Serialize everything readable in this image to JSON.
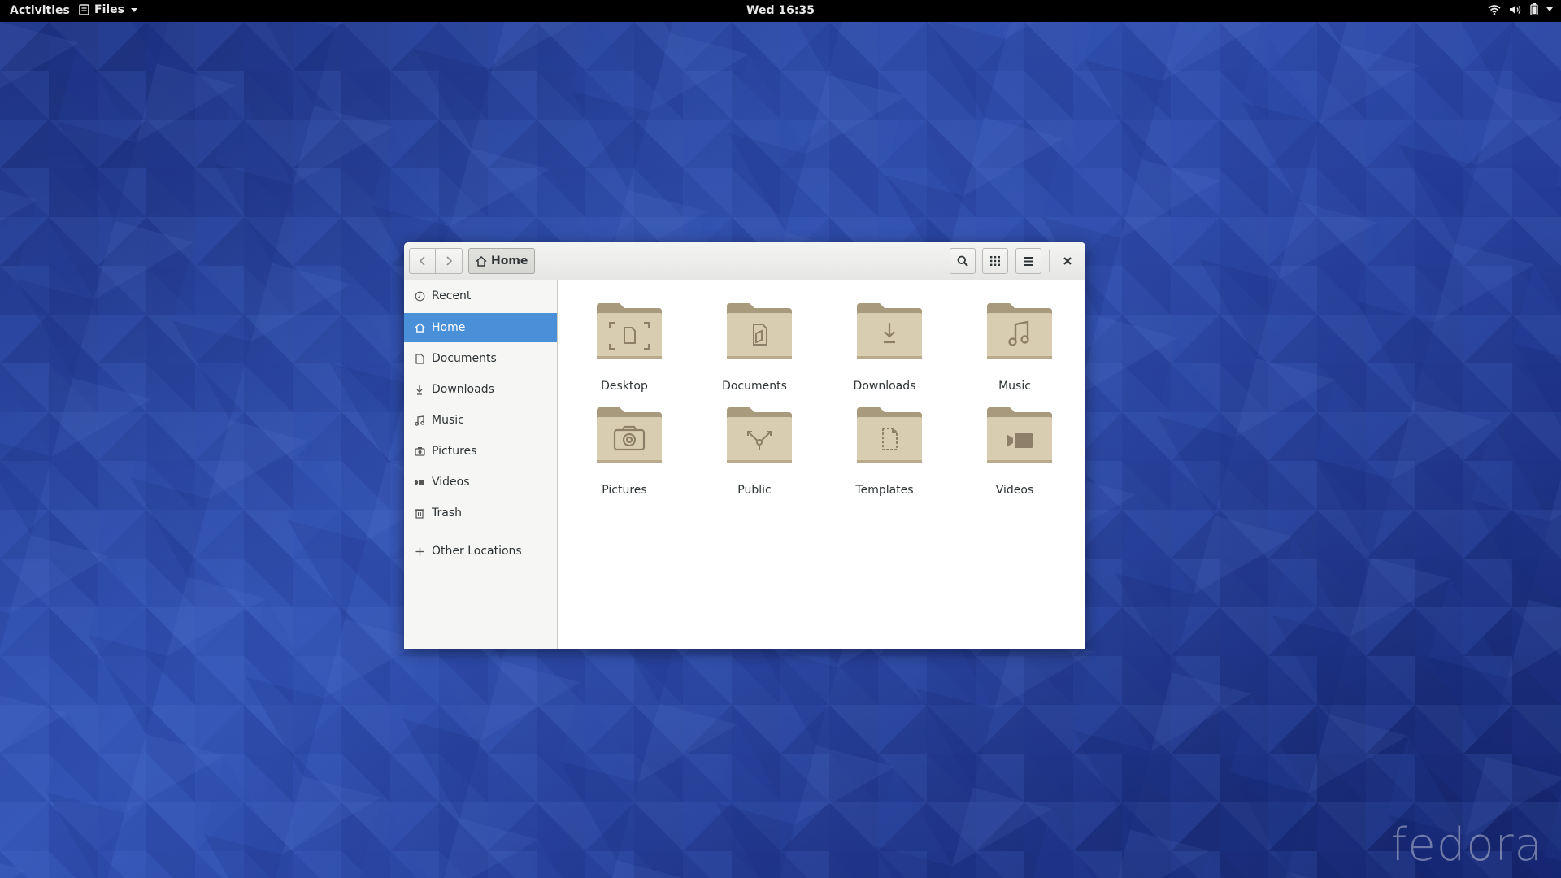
{
  "topbar": {
    "activities_label": "Activities",
    "app_menu_label": "Files",
    "clock": "Wed 16:35",
    "status_icons": [
      "wifi-icon",
      "volume-icon",
      "battery-icon"
    ]
  },
  "desktop": {
    "watermark": "fedora"
  },
  "window": {
    "title": "Home",
    "path": {
      "current": "Home"
    },
    "toolbar": {
      "back_icon": "chevron-left-icon",
      "forward_icon": "chevron-right-icon",
      "search_icon": "search-icon",
      "view_icon": "grid-view-icon",
      "menu_icon": "hamburger-menu-icon",
      "close_icon": "close-icon"
    },
    "sidebar": {
      "items": [
        {
          "label": "Recent",
          "icon": "clock-icon"
        },
        {
          "label": "Home",
          "icon": "home-icon",
          "active": true
        },
        {
          "label": "Documents",
          "icon": "document-icon"
        },
        {
          "label": "Downloads",
          "icon": "download-icon"
        },
        {
          "label": "Music",
          "icon": "music-icon"
        },
        {
          "label": "Pictures",
          "icon": "camera-icon"
        },
        {
          "label": "Videos",
          "icon": "video-icon"
        },
        {
          "label": "Trash",
          "icon": "trash-icon"
        },
        {
          "label": "Other Locations",
          "icon": "plus-icon"
        }
      ]
    },
    "files": [
      {
        "name": "Desktop",
        "icon": "desktop-folder-icon"
      },
      {
        "name": "Documents",
        "icon": "documents-folder-icon"
      },
      {
        "name": "Downloads",
        "icon": "downloads-folder-icon"
      },
      {
        "name": "Music",
        "icon": "music-folder-icon"
      },
      {
        "name": "Pictures",
        "icon": "pictures-folder-icon"
      },
      {
        "name": "Public",
        "icon": "public-folder-icon"
      },
      {
        "name": "Templates",
        "icon": "templates-folder-icon"
      },
      {
        "name": "Videos",
        "icon": "videos-folder-icon"
      }
    ],
    "colors": {
      "accent": "#4a90d9",
      "folder": "#d9cdb1",
      "folder_dark": "#a89a7c"
    }
  }
}
